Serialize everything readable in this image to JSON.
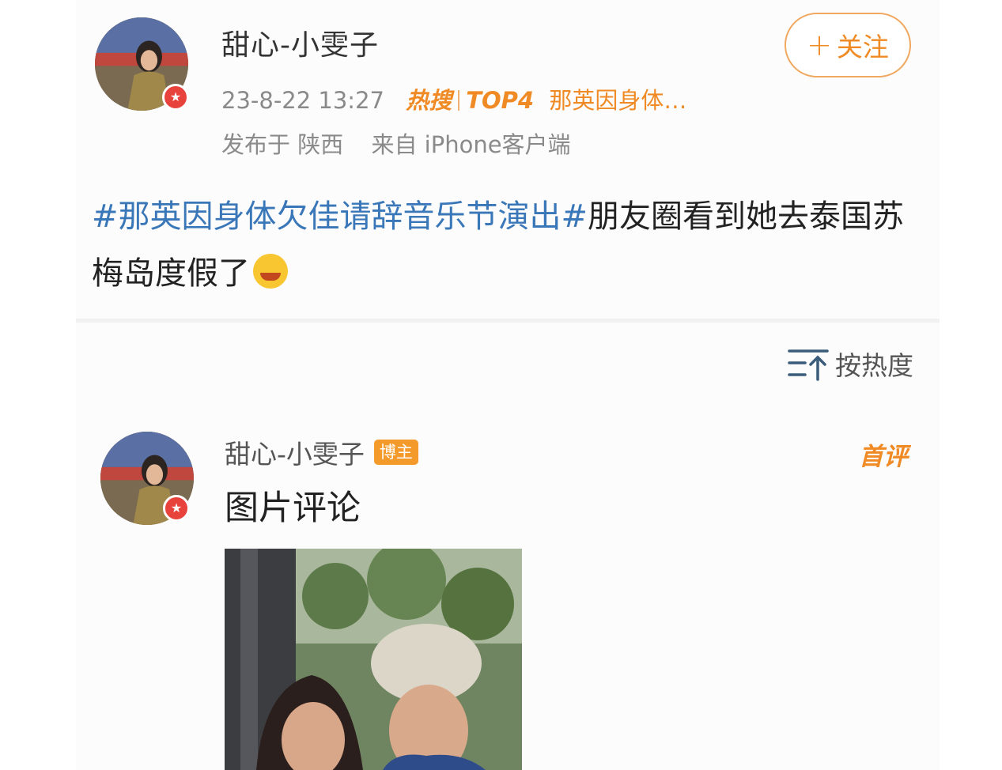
{
  "post": {
    "username": "甜心-小雯子",
    "timestamp": "23-8-22 13:27",
    "hot": {
      "label": "热搜",
      "rank": "TOP4",
      "topic": "那英因身体…"
    },
    "location": "发布于 陕西",
    "source": "来自 iPhone客户端",
    "follow_label": "关注",
    "hashtag": "#那英因身体欠佳请辞音乐节演出#",
    "text": "朋友圈看到她去泰国苏梅岛度假了",
    "emoji": "laugh-cry-emoji"
  },
  "sort": {
    "label": "按热度",
    "icon": "sort-icon"
  },
  "comment": {
    "username": "甜心-小雯子",
    "owner_badge": "博主",
    "first_badge": "首评",
    "text": "图片评论",
    "image": "photo"
  },
  "colors": {
    "accent": "#f08a24",
    "hashtag": "#3a77b8",
    "badge": "#e8423d"
  }
}
